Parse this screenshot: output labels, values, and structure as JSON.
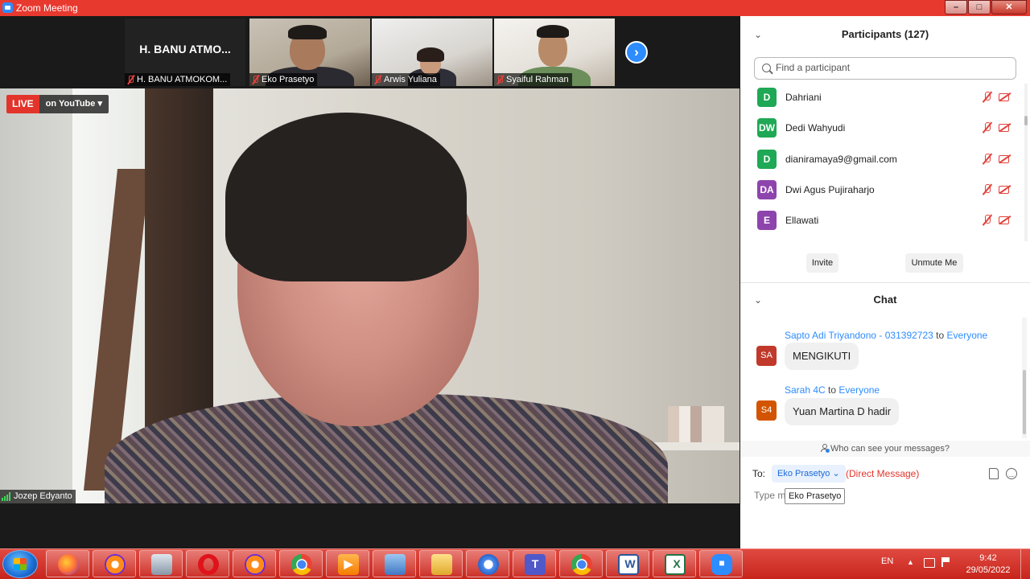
{
  "window": {
    "title": "Zoom Meeting",
    "controls": [
      "minimize",
      "maximize",
      "close"
    ]
  },
  "video_strip": {
    "tiles": [
      {
        "display_name": "H. BANU ATMO...",
        "label": "H. BANU ATMOKOM..."
      },
      {
        "label": "Eko Prasetyo"
      },
      {
        "label": "Arwis Yuliana"
      },
      {
        "label": "Syaiful Rahman"
      }
    ],
    "next_icon": "chevron-right-icon"
  },
  "main_video": {
    "live_badge": "LIVE",
    "live_platform": "on YouTube",
    "speaker_name": "Jozep Edyanto"
  },
  "participants": {
    "title": "Participants (127)",
    "search_placeholder": "Find a participant",
    "list": [
      {
        "initials": "D",
        "name": "Dahriani",
        "color": "#1fa855"
      },
      {
        "initials": "DW",
        "name": "Dedi Wahyudi",
        "color": "#1fa855"
      },
      {
        "initials": "D",
        "name": "dianiramaya9@gmail.com",
        "color": "#1fa855"
      },
      {
        "initials": "DA",
        "name": "Dwi Agus Pujiraharjo",
        "color": "#8e44ad"
      },
      {
        "initials": "E",
        "name": "Ellawati",
        "color": "#8e44ad"
      }
    ],
    "invite_label": "Invite",
    "unmute_label": "Unmute Me"
  },
  "chat": {
    "title": "Chat",
    "messages": [
      {
        "sender": "Sapto Adi Triyandono - 031392723",
        "to_word": "to",
        "recipient": "Everyone",
        "avatar": "SA",
        "avatar_color": "#c0392b",
        "text": "MENGIKUTI"
      },
      {
        "sender": "Sarah 4C",
        "to_word": "to",
        "recipient": "Everyone",
        "avatar": "S4",
        "avatar_color": "#d35400",
        "text": "Yuan Martina D hadir"
      }
    ],
    "who_can_see": "Who can see your messages?",
    "to_label": "To:",
    "to_value": "Eko Prasetyo",
    "direct_message": "(Direct Message)",
    "input_placeholder": "Type m",
    "tooltip": "Eko Prasetyo"
  },
  "taskbar": {
    "apps": [
      "firefox-icon",
      "browser-icon",
      "printer-icon",
      "opera-icon",
      "browser-icon",
      "chrome-icon",
      "media-player-icon",
      "network-icon",
      "folder-icon",
      "chrome-icon",
      "teams-icon",
      "chrome-icon",
      "word-icon",
      "excel-icon",
      "zoom-icon"
    ],
    "language": "EN",
    "time": "9:42",
    "date": "29/05/2022"
  }
}
